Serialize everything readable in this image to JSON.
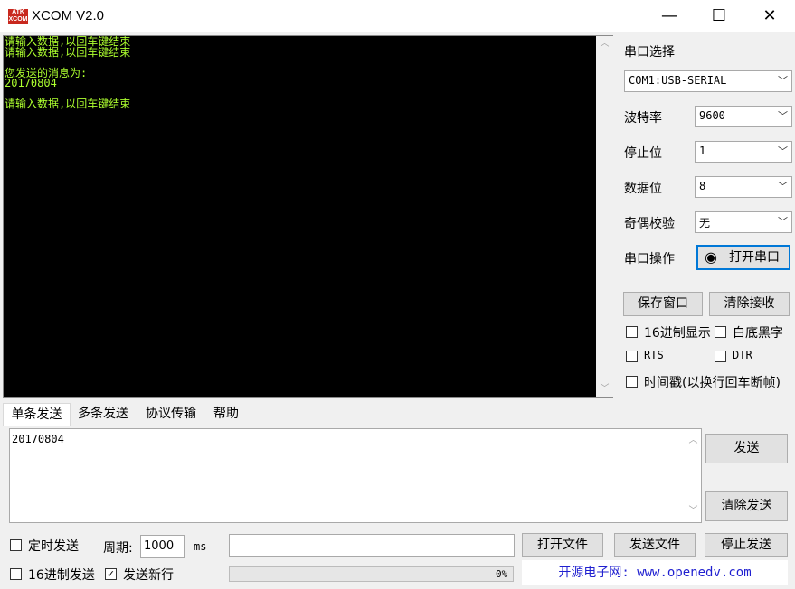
{
  "window": {
    "icon_text": "ATK XCOM",
    "title": "XCOM V2.0",
    "minimize": "—",
    "maximize": "☐",
    "close": "✕"
  },
  "terminal": {
    "text": "请输入数据,以回车键结束\n请输入数据,以回车键结束\n\n您发送的消息为:\n20170804\n\n请输入数据,以回车键结束",
    "color": "#adff2f",
    "background": "#000000"
  },
  "settings": {
    "port_select_label": "串口选择",
    "port_value": "COM1:USB-SERIAL",
    "baud_label": "波特率",
    "baud_value": "9600",
    "stopbits_label": "停止位",
    "stopbits_value": "1",
    "databits_label": "数据位",
    "databits_value": "8",
    "parity_label": "奇偶校验",
    "parity_value": "无",
    "port_op_label": "串口操作",
    "open_port_button": "打开串口"
  },
  "actions": {
    "save_window": "保存窗口",
    "clear_receive": "清除接收"
  },
  "options": {
    "hex_display": "16进制显示",
    "white_bg": "白底黑字",
    "rts": "RTS",
    "dtr": "DTR",
    "timestamp": "时间戳(以换行回车断帧)"
  },
  "tabs": [
    "单条发送",
    "多条发送",
    "协议传输",
    "帮助"
  ],
  "send": {
    "text": "20170804",
    "send_button": "发送",
    "clear_send_button": "清除发送",
    "timed_send": "定时发送",
    "period_label": "周期:",
    "period_value": "1000",
    "period_unit": "ms",
    "open_file": "打开文件",
    "send_file": "发送文件",
    "stop_send": "停止发送",
    "hex_send": "16进制发送",
    "send_newline": "发送新行",
    "send_newline_checked": true,
    "progress_text": "0%",
    "progress": 0,
    "website": "开源电子网: www.openedv.com"
  }
}
